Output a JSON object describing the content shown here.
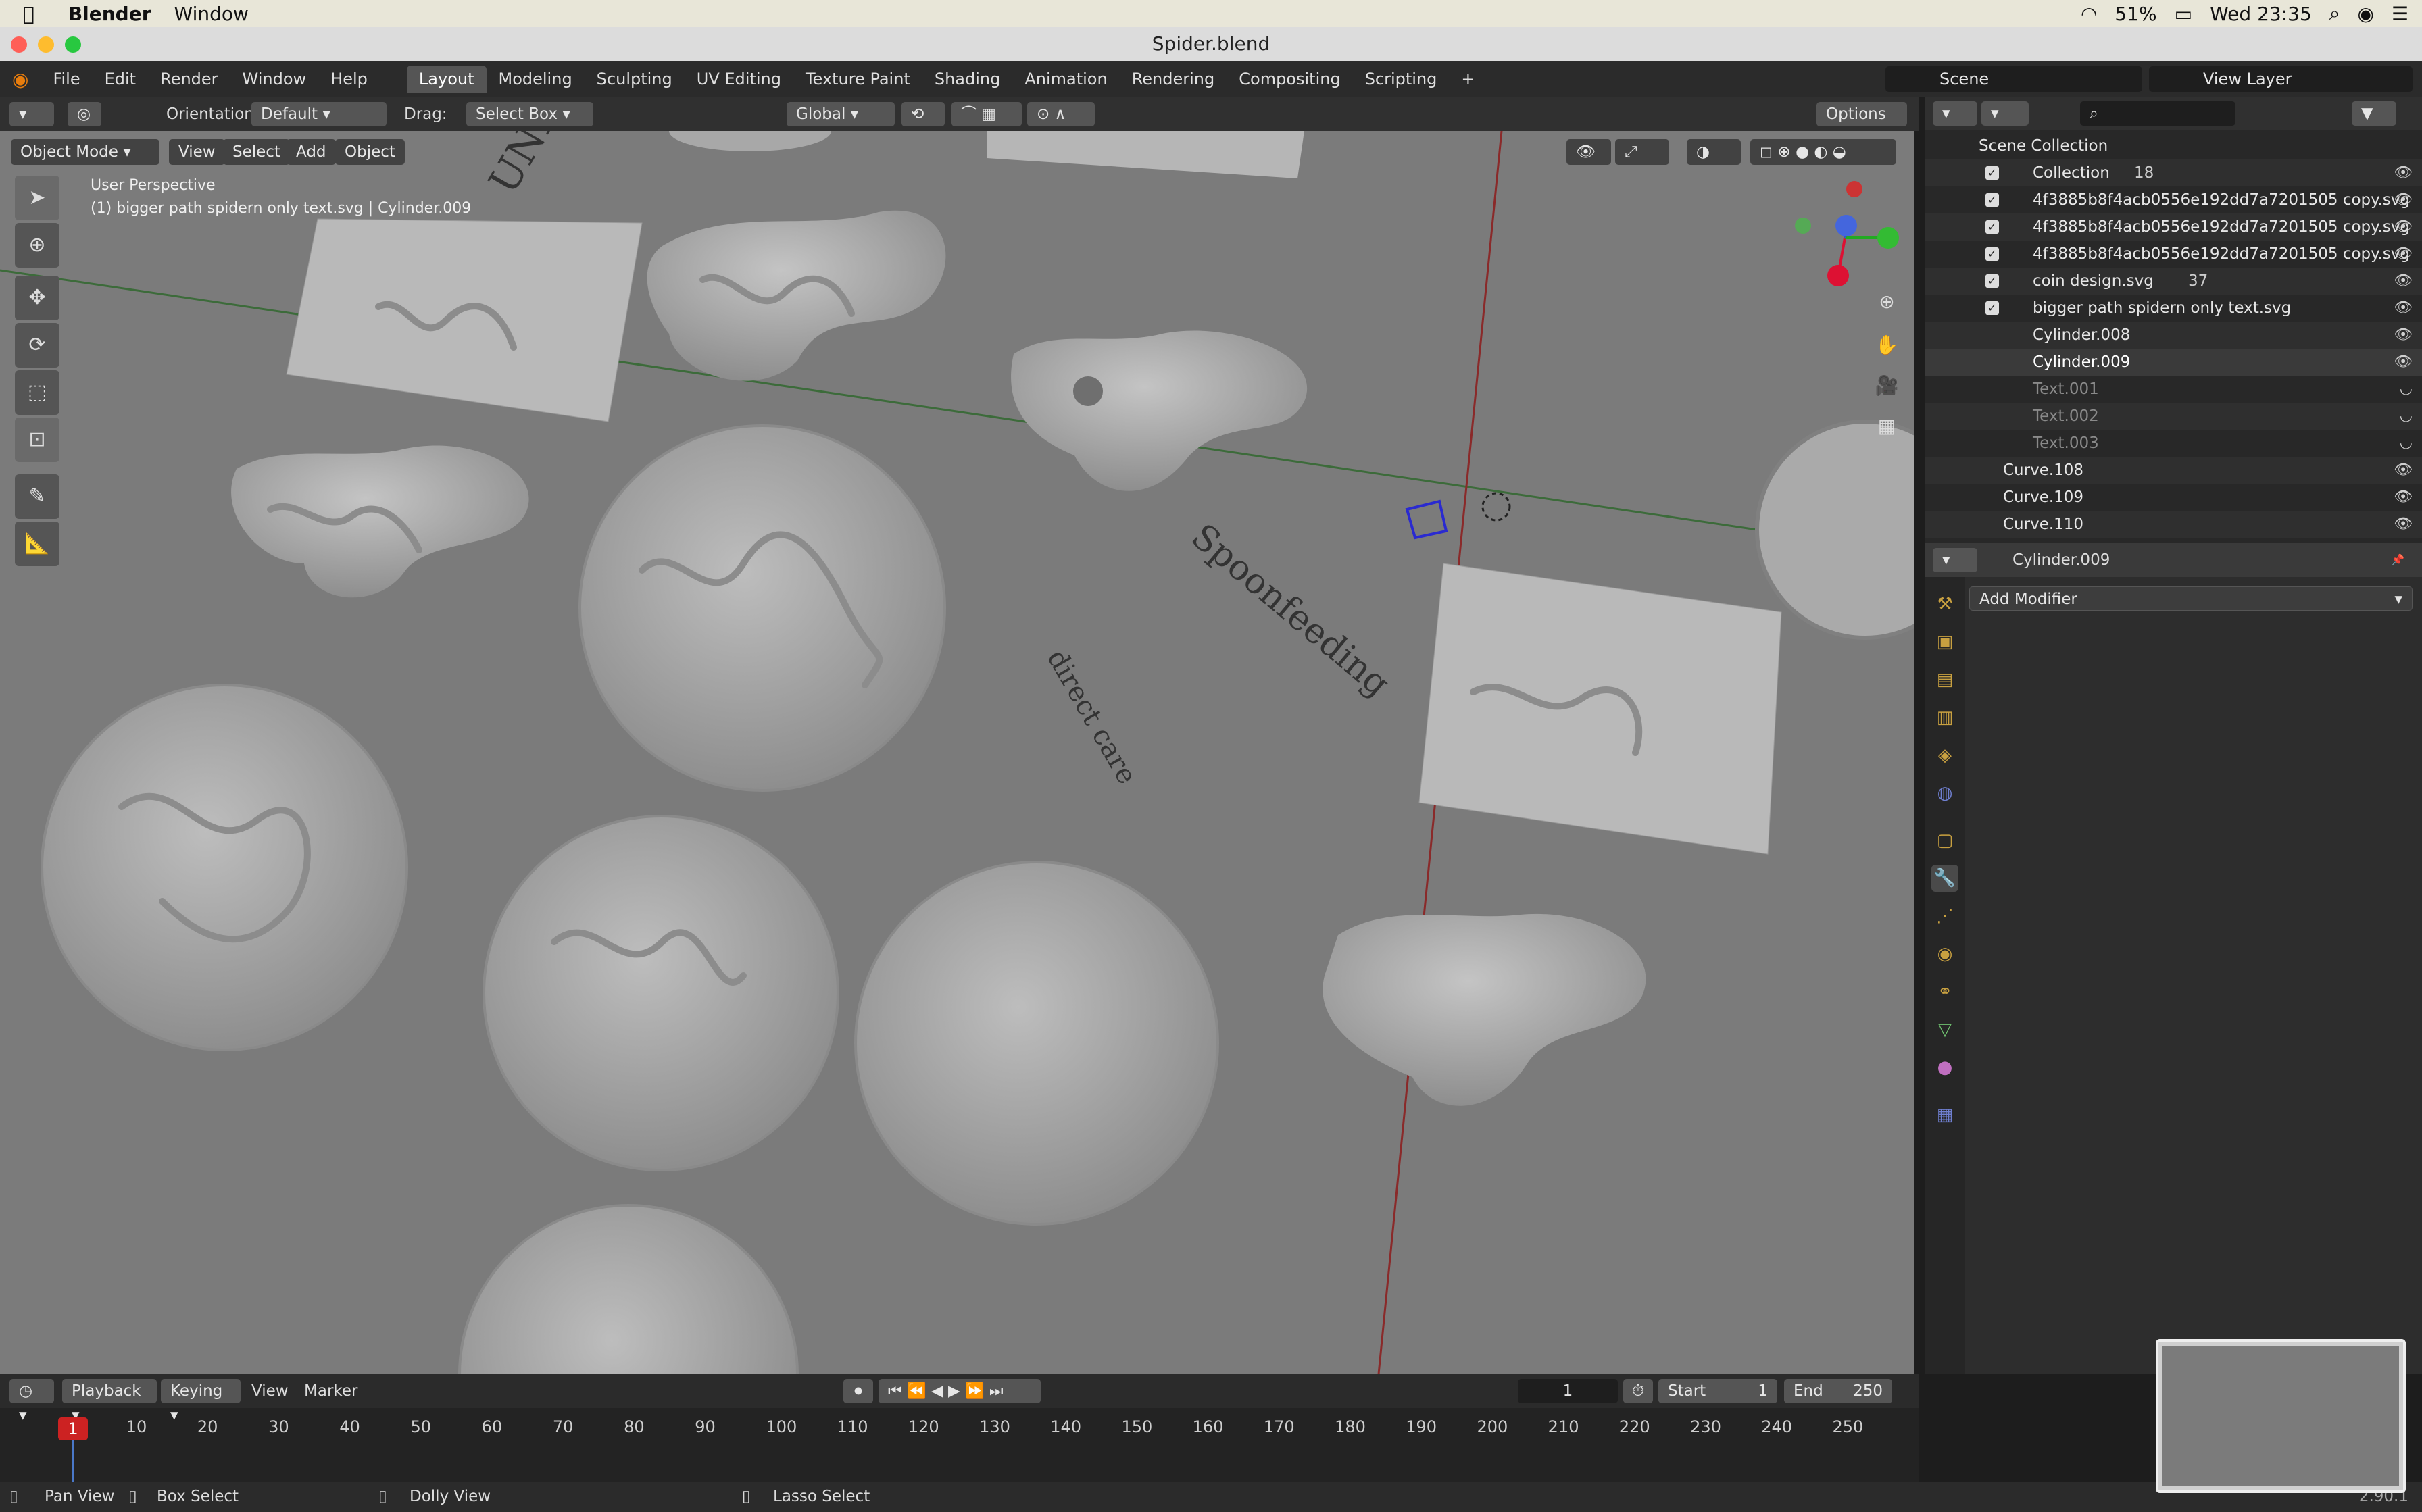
{
  "menubar": {
    "app": "Blender",
    "window_menu": "Window",
    "battery": "51%",
    "clock": "Wed 23:35"
  },
  "window": {
    "title": "Spider.blend"
  },
  "top_menu": {
    "items": [
      "File",
      "Edit",
      "Render",
      "Window",
      "Help"
    ],
    "workspaces": [
      "Layout",
      "Modeling",
      "Sculpting",
      "UV Editing",
      "Texture Paint",
      "Shading",
      "Animation",
      "Rendering",
      "Compositing",
      "Scripting"
    ],
    "active_workspace": "Layout",
    "add_tab": "+",
    "scene_label": "Scene",
    "view_layer_label": "View Layer"
  },
  "header": {
    "orientation_label": "Orientation:",
    "orientation_value": "Default",
    "drag_label": "Drag:",
    "drag_value": "Select Box",
    "transform_value": "Global",
    "options_label": "Options"
  },
  "viewport": {
    "mode": "Object Mode",
    "menus": [
      "View",
      "Select",
      "Add",
      "Object"
    ],
    "perspective": "User Perspective",
    "object_info": "(1) bigger path spidern only text.svg | Cylinder.009",
    "gizmo": {
      "x": "X",
      "y": "Y",
      "z": "Z"
    },
    "curved_text_1": "UNPAID WORK",
    "curved_text_2": "Spoonfeeding",
    "curved_text_3": "direct care"
  },
  "outliner": {
    "root": "Scene Collection",
    "rows": [
      {
        "label": "Collection",
        "badge": "18"
      },
      {
        "label": "4f3885b8f4acb0556e192dd7a7201505 copy.svg"
      },
      {
        "label": "4f3885b8f4acb0556e192dd7a7201505 copy.svg"
      },
      {
        "label": "4f3885b8f4acb0556e192dd7a7201505 copy.svg"
      },
      {
        "label": "coin design.svg",
        "badge": "37"
      },
      {
        "label": "bigger path spidern only text.svg"
      },
      {
        "label": "Cylinder.008"
      },
      {
        "label": "Cylinder.009"
      },
      {
        "label": "Text.001"
      },
      {
        "label": "Text.002"
      },
      {
        "label": "Text.003"
      },
      {
        "label": "Curve.108"
      },
      {
        "label": "Curve.109"
      },
      {
        "label": "Curve.110"
      }
    ]
  },
  "properties": {
    "object_name": "Cylinder.009",
    "add_modifier": "Add Modifier"
  },
  "timeline": {
    "playback": "Playback",
    "keying": "Keying",
    "view": "View",
    "marker": "Marker",
    "current_frame": "1",
    "start_label": "Start",
    "start_value": "1",
    "end_label": "End",
    "end_value": "250",
    "ticks": [
      "1",
      "10",
      "20",
      "30",
      "40",
      "50",
      "60",
      "70",
      "80",
      "90",
      "100",
      "110",
      "120",
      "130",
      "140",
      "150",
      "160",
      "170",
      "180",
      "190",
      "200",
      "210",
      "220",
      "230",
      "240",
      "250"
    ]
  },
  "statusbar": {
    "pan": "Pan View",
    "box": "Box Select",
    "dolly": "Dolly View",
    "lasso": "Lasso Select",
    "version": "2.90.1"
  }
}
